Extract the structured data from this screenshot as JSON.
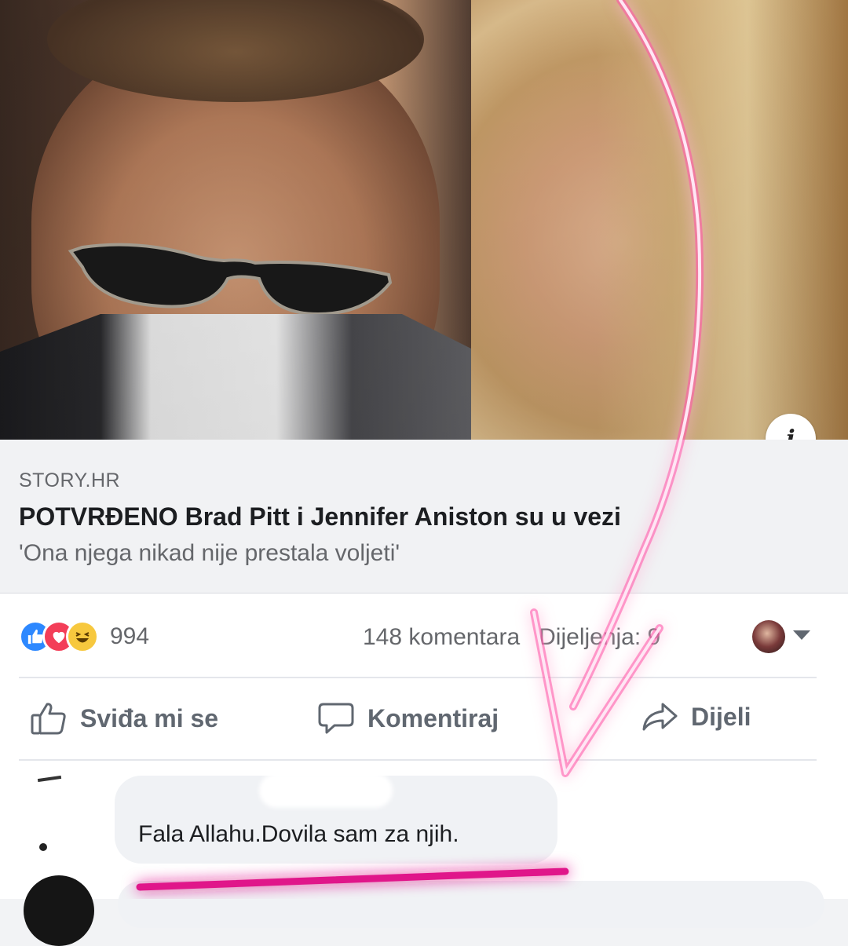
{
  "link_preview": {
    "source": "STORY.HR",
    "headline": "POTVRĐENO Brad Pitt i Jennifer Aniston su u vezi",
    "subtitle": "'Ona njega nikad nije prestala voljeti'",
    "info_glyph": "i"
  },
  "stats": {
    "reactions": [
      "like-icon",
      "love-icon",
      "haha-icon"
    ],
    "reaction_count": "994",
    "comments": "148 komentara",
    "shares": "Dijeljenja: 9"
  },
  "actions": {
    "like": "Sviđa mi se",
    "comment": "Komentiraj",
    "share": "Dijeli"
  },
  "comment": {
    "text": "Fala Allahu.Dovila sam za njih."
  },
  "colors": {
    "facebook_blue": "#2d88ff",
    "love_red": "#f33e58",
    "haha_yellow": "#f7c83e",
    "annotation_pink": "#ff3fa4"
  }
}
